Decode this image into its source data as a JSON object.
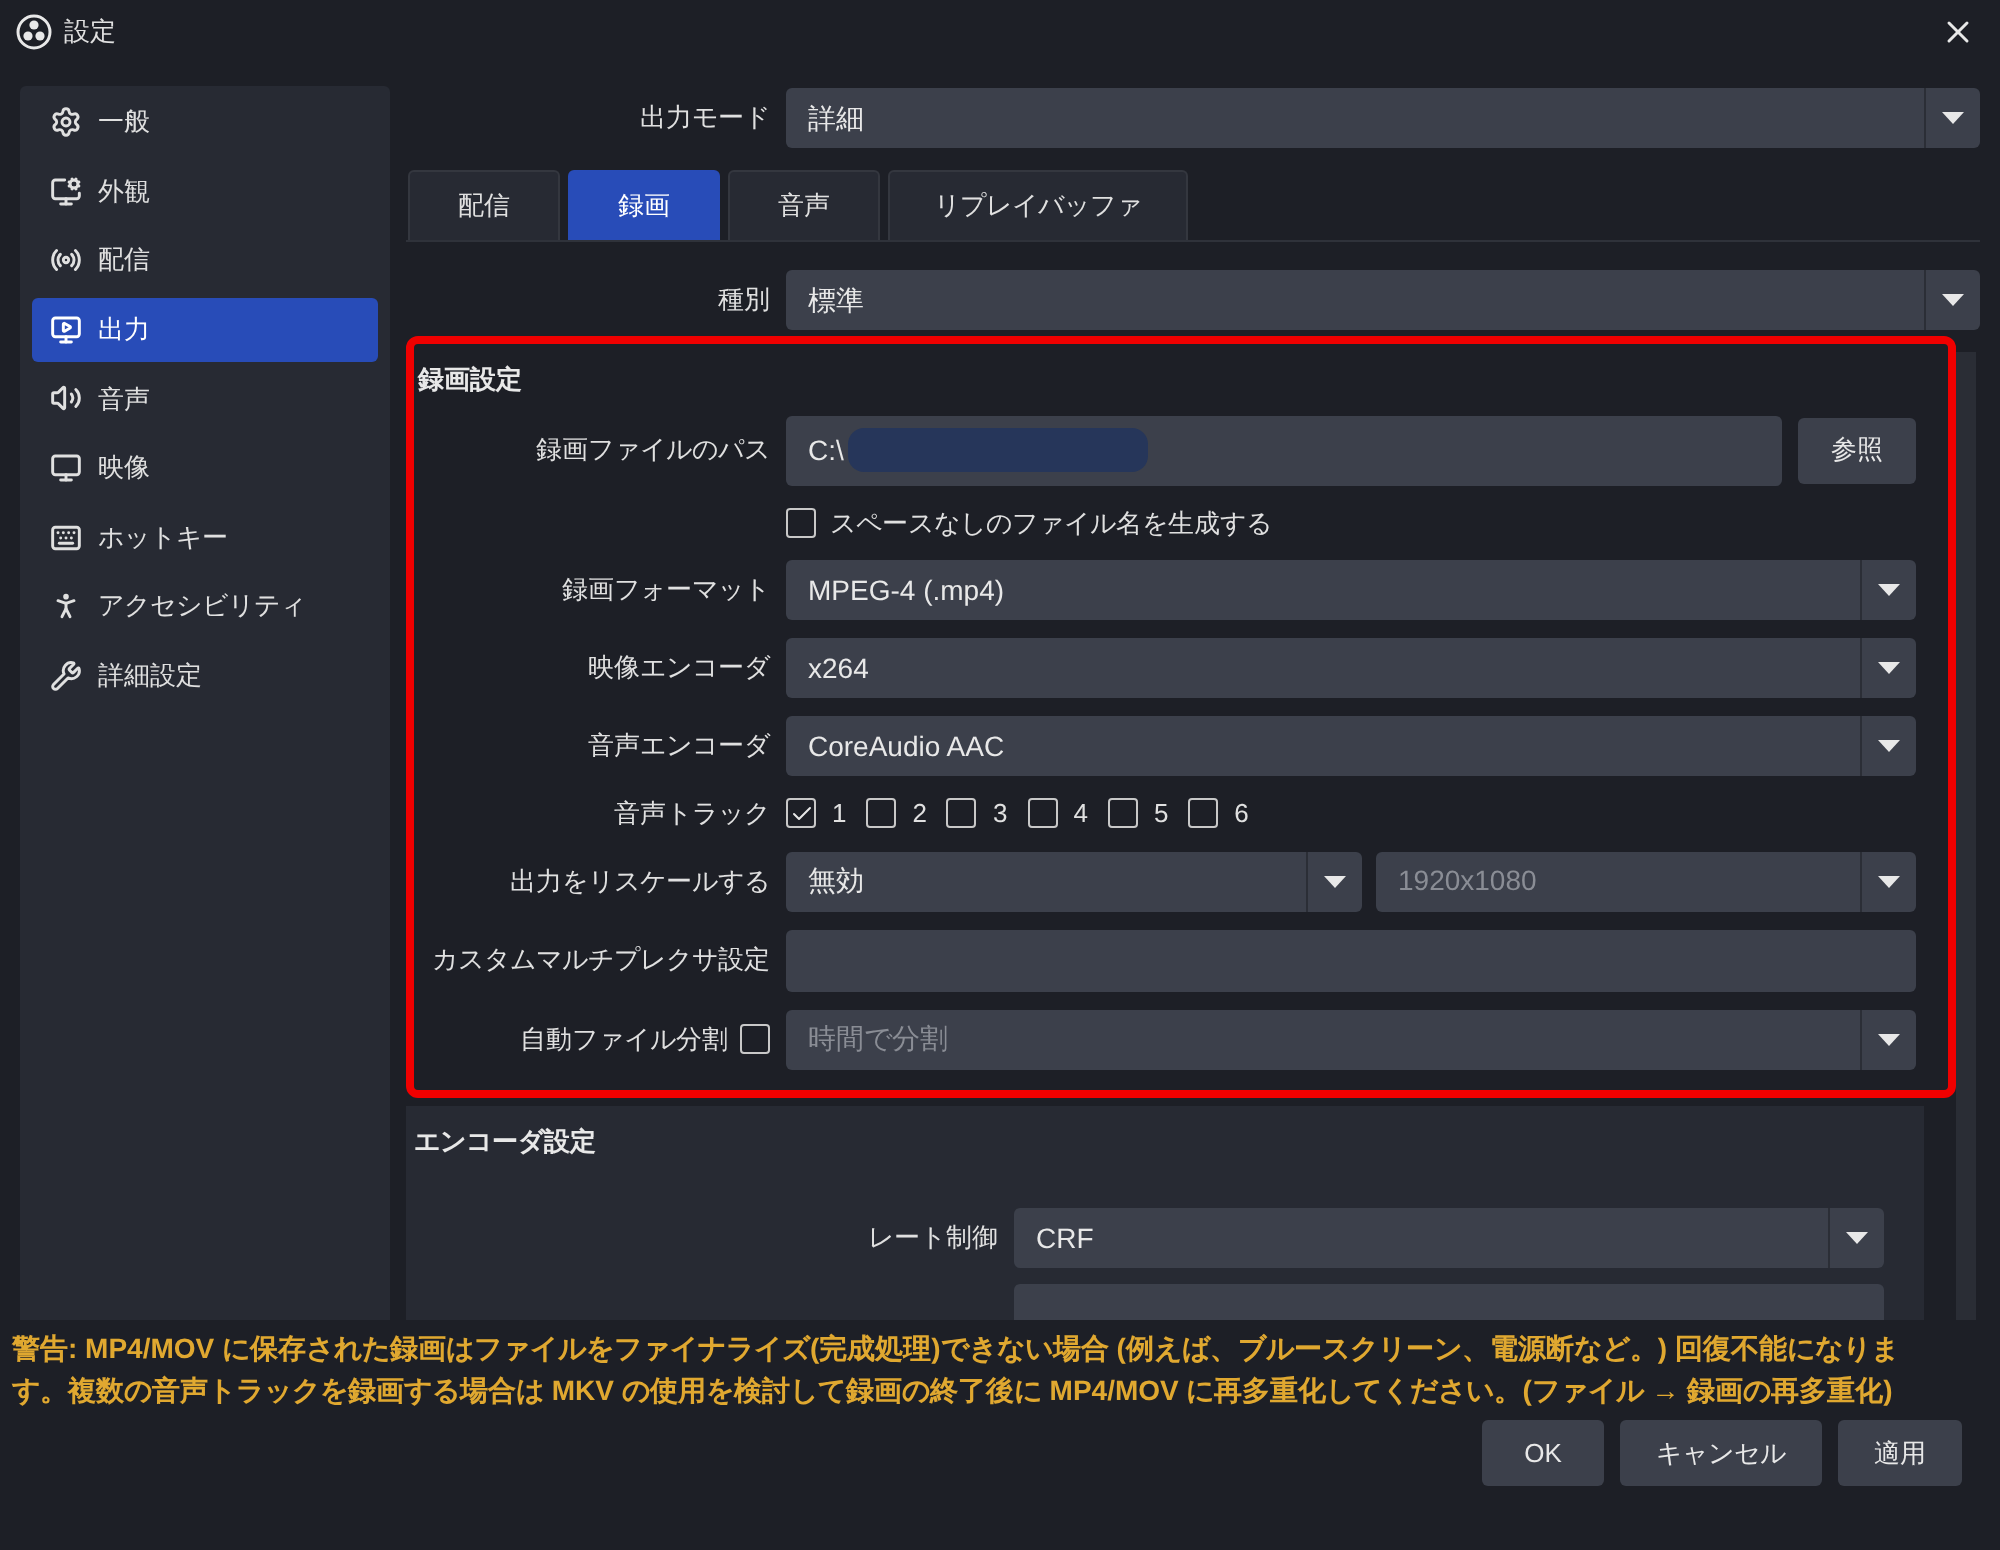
{
  "window": {
    "title": "設定"
  },
  "sidebar": {
    "items": [
      {
        "label": "一般",
        "kind": "general",
        "selected": false
      },
      {
        "label": "外観",
        "kind": "appearance",
        "selected": false
      },
      {
        "label": "配信",
        "kind": "stream",
        "selected": false
      },
      {
        "label": "出力",
        "kind": "output",
        "selected": true
      },
      {
        "label": "音声",
        "kind": "audio",
        "selected": false
      },
      {
        "label": "映像",
        "kind": "video",
        "selected": false
      },
      {
        "label": "ホットキー",
        "kind": "hotkeys",
        "selected": false
      },
      {
        "label": "アクセシビリティ",
        "kind": "accessibility",
        "selected": false
      },
      {
        "label": "詳細設定",
        "kind": "advanced",
        "selected": false
      }
    ]
  },
  "output_mode": {
    "label": "出力モード",
    "value": "詳細"
  },
  "tabs": [
    {
      "label": "配信",
      "selected": false
    },
    {
      "label": "録画",
      "selected": true
    },
    {
      "label": "音声",
      "selected": false
    },
    {
      "label": "リプレイバッファ",
      "selected": false
    }
  ],
  "type": {
    "label": "種別",
    "value": "標準"
  },
  "recording_settings": {
    "title": "録画設定",
    "fields": [
      {
        "kind": "path",
        "label": "録画ファイルのパス",
        "value": "C:\\",
        "button": "参照"
      },
      {
        "kind": "checkbox",
        "label": "スペースなしのファイル名を生成する",
        "checked": false
      },
      {
        "kind": "select",
        "label": "録画フォーマット",
        "value": "MPEG-4 (.mp4)"
      },
      {
        "kind": "select",
        "label": "映像エンコーダ",
        "value": "x264"
      },
      {
        "kind": "select",
        "label": "音声エンコーダ",
        "value": "CoreAudio AAC"
      },
      {
        "kind": "tracks",
        "label": "音声トラック",
        "tracks": [
          {
            "label": "1",
            "checked": true
          },
          {
            "label": "2",
            "checked": false
          },
          {
            "label": "3",
            "checked": false
          },
          {
            "label": "4",
            "checked": false
          },
          {
            "label": "5",
            "checked": false
          },
          {
            "label": "6",
            "checked": false
          }
        ]
      },
      {
        "kind": "rescale",
        "label": "出力をリスケールする",
        "value": "無効",
        "resolution": "1920x1080",
        "resolution_disabled": true
      },
      {
        "kind": "text",
        "label": "カスタムマルチプレクサ設定"
      },
      {
        "kind": "split",
        "label": "自動ファイル分割",
        "checked": false,
        "value": "時間で分割",
        "disabled": true
      }
    ]
  },
  "encoder_settings": {
    "title": "エンコーダ設定",
    "fields": [
      {
        "label": "レート制御",
        "value": "CRF"
      }
    ]
  },
  "warning": "警告: MP4/MOV に保存された録画はファイルをファイナライズ(完成処理)できない場合 (例えば、ブルースクリーン、電源断など。) 回復不能になります。複数の音声トラックを録画する場合は MKV の使用を検討して録画の終了後に MP4/MOV に再多重化してください。(ファイル → 録画の再多重化)",
  "buttons": [
    "OK",
    "キャンセル",
    "適用"
  ]
}
